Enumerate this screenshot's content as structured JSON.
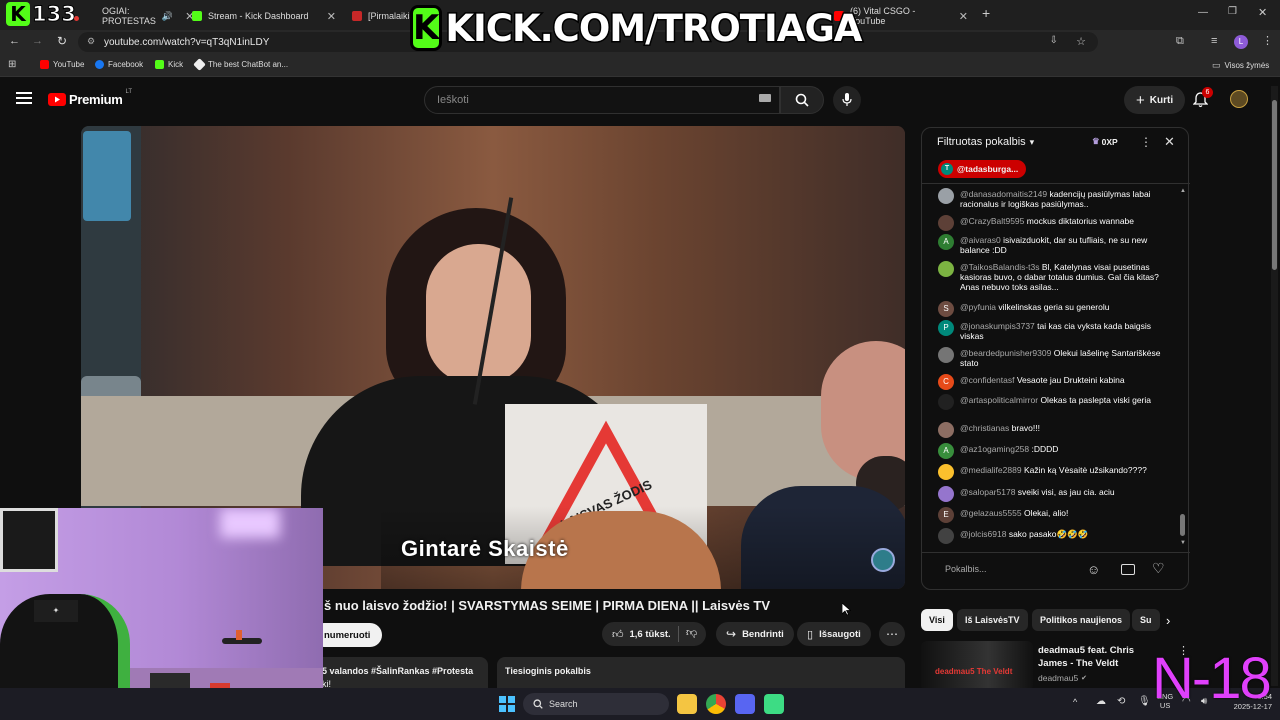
{
  "browser": {
    "tabs": [
      {
        "label": "OGIAI: PROTESTAS"
      },
      {
        "label": "Stream - Kick Dashboard"
      },
      {
        "label": "[Pirmalaikiai"
      },
      {
        "label": "(6) Vital CSGO - YouTube"
      }
    ],
    "new_tab": "+",
    "url": "youtube.com/watch?v=qT3qN1inLDY",
    "bookmarks": [
      "YouTube",
      "Facebook",
      "Kick",
      "The best ChatBot an..."
    ],
    "all_bookmarks": "Visos žymės"
  },
  "youtube": {
    "logo_text": "Premium",
    "logo_badge": "LT",
    "search_placeholder": "Ieškoti",
    "create_label": "Kurti",
    "notif_count": "6"
  },
  "video": {
    "caption_name": "Gintarė Skaistė",
    "sign_text": "LAISVAS ŽODIS",
    "title": "š nuo laisvo žodžio! | SVARSTYMAS SEIME | PIRMA DIENA || Laisvės TV",
    "subscribe_label": "numeruoti",
    "likes": "1,6 tūkst.",
    "share_label": "Bendrinti",
    "save_label": "Išsaugoti",
    "desc_meta": "5 valandos  #ŠalinRankas #Protesta",
    "desc_more": "ki!",
    "live_chat_title": "Tiesioginis pokalbis"
  },
  "chat": {
    "title": "Filtruotas pokalbis",
    "xp": "0XP",
    "pinned_user": "@tadasburga...",
    "input_placeholder": "Pokalbis...",
    "messages": [
      {
        "author": "@danasadomaitis2149",
        "text": "kadencijų pasiūlymas labai racionalus ir logiškas pasiūlymas..",
        "av_color": "#9aa0a6",
        "initial": ""
      },
      {
        "author": "@CrazyBalt9595",
        "text": "mockus diktatorius wannabe",
        "av_color": "#5d4037",
        "initial": ""
      },
      {
        "author": "@aivaras0",
        "text": "isivaizduokit, dar su tufliais, ne su new balance :DD",
        "av_color": "#2e7d32",
        "initial": "A"
      },
      {
        "author": "@TaikosBalandis-t3s",
        "text": "Bl, Katelynas visai pusetinas kasioras buvo, o dabar totalus dumius. Gal čia kitas? Anas nebuvo toks asilas...",
        "av_color": "#7cb342",
        "initial": ""
      },
      {
        "author": "@pyfunia",
        "text": "vilkelinskas geria su generolu",
        "av_color": "#6d4c41",
        "initial": "S"
      },
      {
        "author": "@jonaskumpis3737",
        "text": "tai kas cia vyksta kada baigsis viskas",
        "av_color": "#00897b",
        "initial": "P"
      },
      {
        "author": "@beardedpunisher9309",
        "text": "Olekui lašelinę Santariškėse stato",
        "av_color": "#757575",
        "initial": ""
      },
      {
        "author": "@confidentasf",
        "text": "Vesaote jau Drukteini kabina",
        "av_color": "#e64a19",
        "initial": "C"
      },
      {
        "author": "@artaspoliticalmirror",
        "text": "Olekas ta paslepta viski geria",
        "av_color": "#212121",
        "initial": ""
      },
      {
        "author": "@christianas",
        "text": "bravo!!!",
        "av_color": "#8d6e63",
        "initial": ""
      },
      {
        "author": "@az1ogaming258",
        "text": ":DDDD",
        "av_color": "#388e3c",
        "initial": "A"
      },
      {
        "author": "@medialife2889",
        "text": "Kažin ką Vėsaitė užsikando????",
        "av_color": "#fbc02d",
        "initial": ""
      },
      {
        "author": "@salopar5178",
        "text": "sveiki visi, as jau cia. aciu",
        "av_color": "#9575cd",
        "initial": ""
      },
      {
        "author": "@gelazaus5555",
        "text": "Olekai, alio!",
        "av_color": "#5d4037",
        "initial": "E"
      },
      {
        "author": "@jolcis6918",
        "text": "sako pasako🤣🤣🤣",
        "av_color": "#424242",
        "initial": ""
      }
    ]
  },
  "chips": [
    "Visi",
    "Iš LaisvėsTV",
    "Politikos naujienos",
    "Su"
  ],
  "recommended": {
    "title": "deadmau5 feat. Chris James - The Veldt",
    "channel": "deadmau5",
    "thumb_text": "deadmau5 The Veldt"
  },
  "taskbar": {
    "search_label": "Search",
    "lang": "ENG",
    "region": "US",
    "time": "6:54",
    "date": "2025-12-17"
  },
  "overlay": {
    "viewer_count": "133",
    "banner_url": "KICK.COM/TROTIAGA",
    "kick_letter": "K",
    "age_rating": "N-18"
  },
  "colors": {
    "kick_green": "#53fc18",
    "yt_red": "#ff0000",
    "n18_magenta": "#e040fb",
    "chat_pin_red": "#cc0000"
  }
}
